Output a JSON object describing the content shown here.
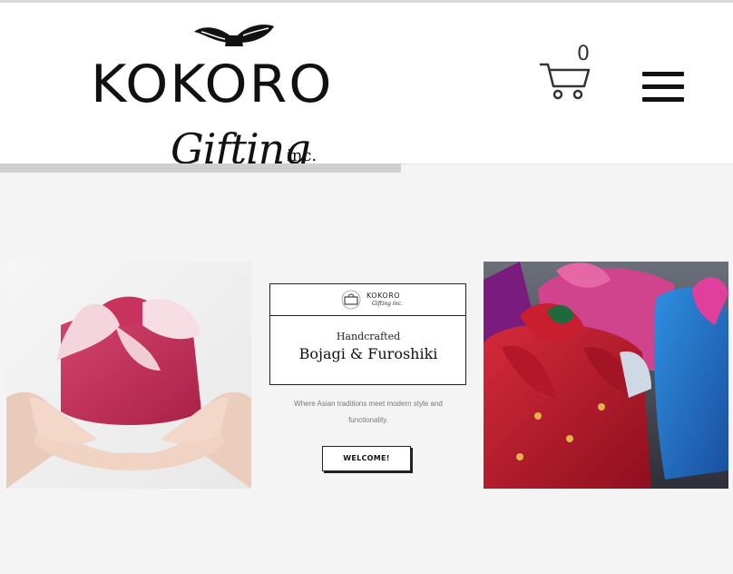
{
  "header": {
    "brand": "KOKORO",
    "script_name": "Gifting",
    "suffix": "inc.",
    "cart_count": "0"
  },
  "center": {
    "card_brand": "KOKORO",
    "card_sub": "Gifting inc.",
    "heading_small": "Handcrafted",
    "heading_large": "Bojagi & Furoshiki",
    "tagline_line1": "Where Asian traditions meet modern style and",
    "tagline_line2": "functionality.",
    "button_label": "WELCOME!"
  },
  "colors": {
    "header_bg": "#ffffff",
    "page_bg": "#f4f4f4",
    "ink": "#111111",
    "wrap_pink": "#c2305a",
    "wrap_red": "#b0162a"
  },
  "icons": [
    "bow-icon",
    "cart-icon",
    "menu-icon"
  ]
}
